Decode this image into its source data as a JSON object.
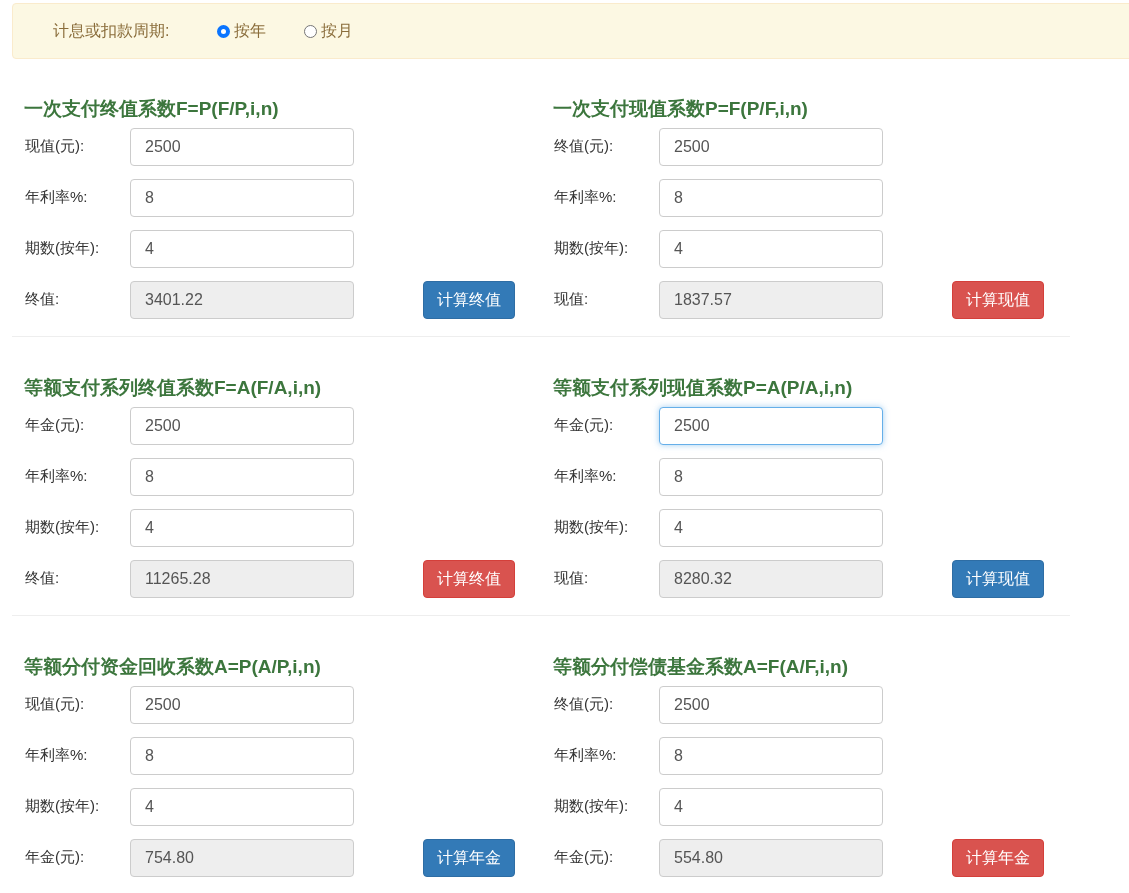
{
  "period": {
    "label": "计息或扣款周期:",
    "options": [
      {
        "label": "按年",
        "selected": true
      },
      {
        "label": "按月",
        "selected": false
      }
    ]
  },
  "sections": [
    {
      "title": "一次支付终值系数F=P(F/P,i,n)",
      "fields": [
        {
          "label": "现值(元):",
          "value": "2500",
          "kind": "input",
          "focused": false
        },
        {
          "label": "年利率%:",
          "value": "8",
          "kind": "input",
          "focused": false
        },
        {
          "label": "期数(按年):",
          "value": "4",
          "kind": "input",
          "focused": false
        },
        {
          "label": "终值:",
          "value": "3401.22",
          "kind": "result",
          "focused": false
        }
      ],
      "button": {
        "label": "计算终值",
        "kind": "primary"
      }
    },
    {
      "title": "一次支付现值系数P=F(P/F,i,n)",
      "fields": [
        {
          "label": "终值(元):",
          "value": "2500",
          "kind": "input",
          "focused": false
        },
        {
          "label": "年利率%:",
          "value": "8",
          "kind": "input",
          "focused": false
        },
        {
          "label": "期数(按年):",
          "value": "4",
          "kind": "input",
          "focused": false
        },
        {
          "label": "现值:",
          "value": "1837.57",
          "kind": "result",
          "focused": false
        }
      ],
      "button": {
        "label": "计算现值",
        "kind": "danger"
      }
    },
    {
      "title": "等额支付系列终值系数F=A(F/A,i,n)",
      "fields": [
        {
          "label": "年金(元):",
          "value": "2500",
          "kind": "input",
          "focused": false
        },
        {
          "label": "年利率%:",
          "value": "8",
          "kind": "input",
          "focused": false
        },
        {
          "label": "期数(按年):",
          "value": "4",
          "kind": "input",
          "focused": false
        },
        {
          "label": "终值:",
          "value": "11265.28",
          "kind": "result",
          "focused": false
        }
      ],
      "button": {
        "label": "计算终值",
        "kind": "danger"
      }
    },
    {
      "title": "等额支付系列现值系数P=A(P/A,i,n)",
      "fields": [
        {
          "label": "年金(元):",
          "value": "2500",
          "kind": "input",
          "focused": true
        },
        {
          "label": "年利率%:",
          "value": "8",
          "kind": "input",
          "focused": false
        },
        {
          "label": "期数(按年):",
          "value": "4",
          "kind": "input",
          "focused": false
        },
        {
          "label": "现值:",
          "value": "8280.32",
          "kind": "result",
          "focused": false
        }
      ],
      "button": {
        "label": "计算现值",
        "kind": "primary"
      }
    },
    {
      "title": "等额分付资金回收系数A=P(A/P,i,n)",
      "fields": [
        {
          "label": "现值(元):",
          "value": "2500",
          "kind": "input",
          "focused": false
        },
        {
          "label": "年利率%:",
          "value": "8",
          "kind": "input",
          "focused": false
        },
        {
          "label": "期数(按年):",
          "value": "4",
          "kind": "input",
          "focused": false
        },
        {
          "label": "年金(元):",
          "value": "754.80",
          "kind": "result",
          "focused": false
        }
      ],
      "button": {
        "label": "计算年金",
        "kind": "primary"
      }
    },
    {
      "title": "等额分付偿债基金系数A=F(A/F,i,n)",
      "fields": [
        {
          "label": "终值(元):",
          "value": "2500",
          "kind": "input",
          "focused": false
        },
        {
          "label": "年利率%:",
          "value": "8",
          "kind": "input",
          "focused": false
        },
        {
          "label": "期数(按年):",
          "value": "4",
          "kind": "input",
          "focused": false
        },
        {
          "label": "年金(元):",
          "value": "554.80",
          "kind": "result",
          "focused": false
        }
      ],
      "button": {
        "label": "计算年金",
        "kind": "danger"
      }
    }
  ]
}
